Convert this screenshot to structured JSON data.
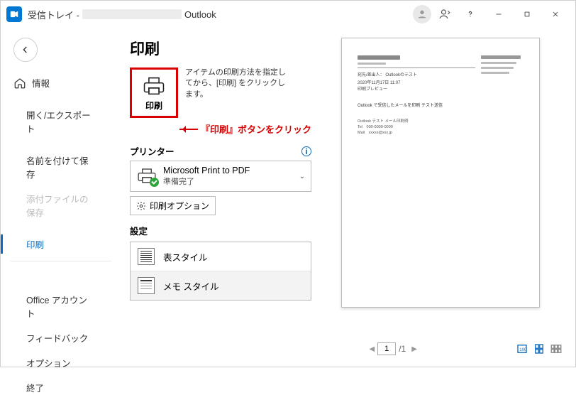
{
  "titlebar": {
    "inbox_label": "受信トレイ - ",
    "app_name": "Outlook"
  },
  "sidebar": {
    "info": "情報",
    "open_export": "開く/エクスポート",
    "save_as": "名前を付けて保存",
    "save_attachments": "添付ファイルの保存",
    "print": "印刷",
    "office_account": "Office アカウント",
    "feedback": "フィードバック",
    "options": "オプション",
    "exit": "終了"
  },
  "main": {
    "heading": "印刷",
    "print_button_label": "印刷",
    "print_description": "アイテムの印刷方法を指定してから、[印刷] をクリックします。",
    "annotation": "『印刷』ボタンをクリック",
    "printer_section": "プリンター",
    "printer_name": "Microsoft Print to PDF",
    "printer_status": "準備完了",
    "print_options": "印刷オプション",
    "settings_section": "設定",
    "style_table": "表スタイル",
    "style_memo": "メモ スタイル"
  },
  "preview": {
    "line_subject": "Outlook で受信したメールを印刷 テスト送信",
    "line_from_label": "宛先/差出人：",
    "line_from_value": "Outlookのテスト",
    "line_date": "2020年11月17日 11:07",
    "line_extra": "印刷プレビュー",
    "body1": "Outlook テスト メール印刷例",
    "body2": "Tel　000-0000-0000",
    "body3": "Mail　xxxxx@xxx.jp"
  },
  "pager": {
    "current": "1",
    "total": "/1"
  }
}
